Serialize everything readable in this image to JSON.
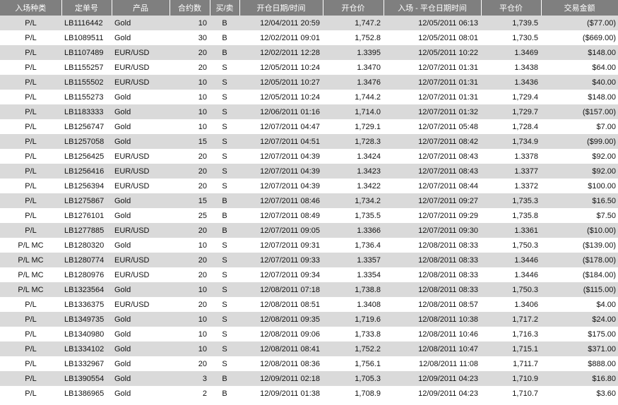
{
  "table": {
    "headers": [
      "入场种类",
      "定单号",
      "产品",
      "合约数",
      "买/卖",
      "开仓日期/时间",
      "开仓价",
      "入场 - 平仓日期时间",
      "平仓价",
      "交易金额"
    ],
    "rows": [
      [
        "P/L",
        "LB1116442",
        "Gold",
        "10",
        "B",
        "12/04/2011 20:59",
        "1,747.2",
        "12/05/2011 06:13",
        "1,739.5",
        "($77.00)"
      ],
      [
        "P/L",
        "LB1089511",
        "Gold",
        "30",
        "B",
        "12/02/2011 09:01",
        "1,752.8",
        "12/05/2011 08:01",
        "1,730.5",
        "($669.00)"
      ],
      [
        "P/L",
        "LB1107489",
        "EUR/USD",
        "20",
        "B",
        "12/02/2011 12:28",
        "1.3395",
        "12/05/2011 10:22",
        "1.3469",
        "$148.00"
      ],
      [
        "P/L",
        "LB1155257",
        "EUR/USD",
        "20",
        "S",
        "12/05/2011 10:24",
        "1.3470",
        "12/07/2011 01:31",
        "1.3438",
        "$64.00"
      ],
      [
        "P/L",
        "LB1155502",
        "EUR/USD",
        "10",
        "S",
        "12/05/2011 10:27",
        "1.3476",
        "12/07/2011 01:31",
        "1.3436",
        "$40.00"
      ],
      [
        "P/L",
        "LB1155273",
        "Gold",
        "10",
        "S",
        "12/05/2011 10:24",
        "1,744.2",
        "12/07/2011 01:31",
        "1,729.4",
        "$148.00"
      ],
      [
        "P/L",
        "LB1183333",
        "Gold",
        "10",
        "S",
        "12/06/2011 01:16",
        "1,714.0",
        "12/07/2011 01:32",
        "1,729.7",
        "($157.00)"
      ],
      [
        "P/L",
        "LB1256747",
        "Gold",
        "10",
        "S",
        "12/07/2011 04:47",
        "1,729.1",
        "12/07/2011 05:48",
        "1,728.4",
        "$7.00"
      ],
      [
        "P/L",
        "LB1257058",
        "Gold",
        "15",
        "S",
        "12/07/2011 04:51",
        "1,728.3",
        "12/07/2011 08:42",
        "1,734.9",
        "($99.00)"
      ],
      [
        "P/L",
        "LB1256425",
        "EUR/USD",
        "20",
        "S",
        "12/07/2011 04:39",
        "1.3424",
        "12/07/2011 08:43",
        "1.3378",
        "$92.00"
      ],
      [
        "P/L",
        "LB1256416",
        "EUR/USD",
        "20",
        "S",
        "12/07/2011 04:39",
        "1.3423",
        "12/07/2011 08:43",
        "1.3377",
        "$92.00"
      ],
      [
        "P/L",
        "LB1256394",
        "EUR/USD",
        "20",
        "S",
        "12/07/2011 04:39",
        "1.3422",
        "12/07/2011 08:44",
        "1.3372",
        "$100.00"
      ],
      [
        "P/L",
        "LB1275867",
        "Gold",
        "15",
        "B",
        "12/07/2011 08:46",
        "1,734.2",
        "12/07/2011 09:27",
        "1,735.3",
        "$16.50"
      ],
      [
        "P/L",
        "LB1276101",
        "Gold",
        "25",
        "B",
        "12/07/2011 08:49",
        "1,735.5",
        "12/07/2011 09:29",
        "1,735.8",
        "$7.50"
      ],
      [
        "P/L",
        "LB1277885",
        "EUR/USD",
        "20",
        "B",
        "12/07/2011 09:05",
        "1.3366",
        "12/07/2011 09:30",
        "1.3361",
        "($10.00)"
      ],
      [
        "P/L MC",
        "LB1280320",
        "Gold",
        "10",
        "S",
        "12/07/2011 09:31",
        "1,736.4",
        "12/08/2011 08:33",
        "1,750.3",
        "($139.00)"
      ],
      [
        "P/L MC",
        "LB1280774",
        "EUR/USD",
        "20",
        "S",
        "12/07/2011 09:33",
        "1.3357",
        "12/08/2011 08:33",
        "1.3446",
        "($178.00)"
      ],
      [
        "P/L MC",
        "LB1280976",
        "EUR/USD",
        "20",
        "S",
        "12/07/2011 09:34",
        "1.3354",
        "12/08/2011 08:33",
        "1.3446",
        "($184.00)"
      ],
      [
        "P/L MC",
        "LB1323564",
        "Gold",
        "10",
        "S",
        "12/08/2011 07:18",
        "1,738.8",
        "12/08/2011 08:33",
        "1,750.3",
        "($115.00)"
      ],
      [
        "P/L",
        "LB1336375",
        "EUR/USD",
        "20",
        "S",
        "12/08/2011 08:51",
        "1.3408",
        "12/08/2011 08:57",
        "1.3406",
        "$4.00"
      ],
      [
        "P/L",
        "LB1349735",
        "Gold",
        "10",
        "S",
        "12/08/2011 09:35",
        "1,719.6",
        "12/08/2011 10:38",
        "1,717.2",
        "$24.00"
      ],
      [
        "P/L",
        "LB1340980",
        "Gold",
        "10",
        "S",
        "12/08/2011 09:06",
        "1,733.8",
        "12/08/2011 10:46",
        "1,716.3",
        "$175.00"
      ],
      [
        "P/L",
        "LB1334102",
        "Gold",
        "10",
        "S",
        "12/08/2011 08:41",
        "1,752.2",
        "12/08/2011 10:47",
        "1,715.1",
        "$371.00"
      ],
      [
        "P/L",
        "LB1332967",
        "Gold",
        "20",
        "S",
        "12/08/2011 08:36",
        "1,756.1",
        "12/08/2011 11:08",
        "1,711.7",
        "$888.00"
      ],
      [
        "P/L",
        "LB1390554",
        "Gold",
        "3",
        "B",
        "12/09/2011 02:18",
        "1,705.3",
        "12/09/2011 04:23",
        "1,710.9",
        "$16.80"
      ],
      [
        "P/L",
        "LB1386965",
        "Gold",
        "2",
        "B",
        "12/09/2011 01:38",
        "1,708.9",
        "12/09/2011 04:23",
        "1,710.7",
        "$3.60"
      ]
    ]
  }
}
